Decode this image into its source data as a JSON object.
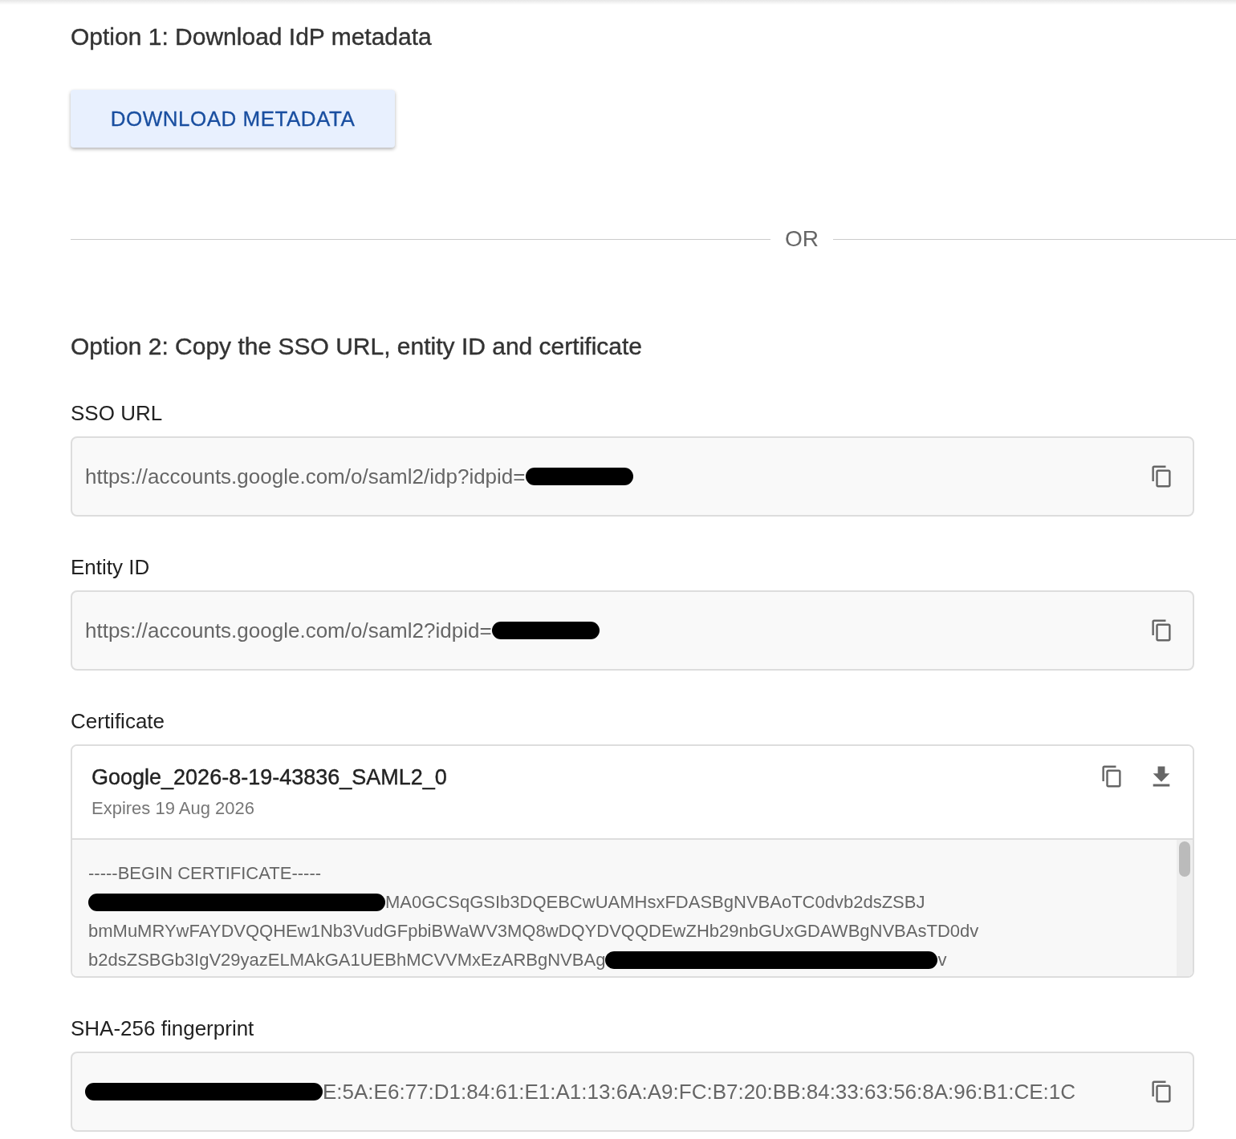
{
  "option1": {
    "heading": "Option 1: Download IdP metadata",
    "button": "DOWNLOAD METADATA"
  },
  "divider": {
    "label": "OR"
  },
  "option2": {
    "heading": "Option 2: Copy the SSO URL, entity ID and certificate",
    "fields": [
      {
        "label": "SSO URL",
        "segments": [
          {
            "kind": "text",
            "text": "https://accounts.google.com/o/saml2/idp?idpid="
          },
          {
            "kind": "redacted"
          }
        ]
      },
      {
        "label": "Entity ID",
        "segments": [
          {
            "kind": "text",
            "text": "https://accounts.google.com/o/saml2?idpid="
          },
          {
            "kind": "redacted"
          }
        ]
      }
    ],
    "certificate": {
      "label": "Certificate",
      "name": "Google_2026-8-19-43836_SAML2_0",
      "expires": "Expires 19 Aug 2026",
      "lines": [
        [
          {
            "kind": "text",
            "text": "-----BEGIN CERTIFICATE-----"
          }
        ],
        [
          {
            "kind": "redacted"
          },
          {
            "kind": "text",
            "text": "MA0GCSqGSIb3DQEBCwUAMHsxFDASBgNVBAoTC0dvb2dsZSBJ"
          }
        ],
        [
          {
            "kind": "text",
            "text": "bmMuMRYwFAYDVQQHEw1Nb3VudGFpbiBWaWV3MQ8wDQYDVQQDEwZHb29nbGUxGDAWBgNVBAsTD0dv"
          }
        ],
        [
          {
            "kind": "text",
            "text": "b2dsZSBGb3IgV29yazELMAkGA1UEBhMCVVMxEzARBgNVBAg"
          },
          {
            "kind": "redacted"
          },
          {
            "kind": "text",
            "text": "v"
          }
        ]
      ]
    },
    "fingerprint": {
      "label": "SHA-256 fingerprint",
      "segments": [
        {
          "kind": "redacted"
        },
        {
          "kind": "text",
          "text": "E:5A:E6:77:D1:84:61:E1:A1:13:6A:A9:FC:B7:20:BB:84:33:63:56:8A:96:B1:CE:1C"
        }
      ]
    }
  }
}
